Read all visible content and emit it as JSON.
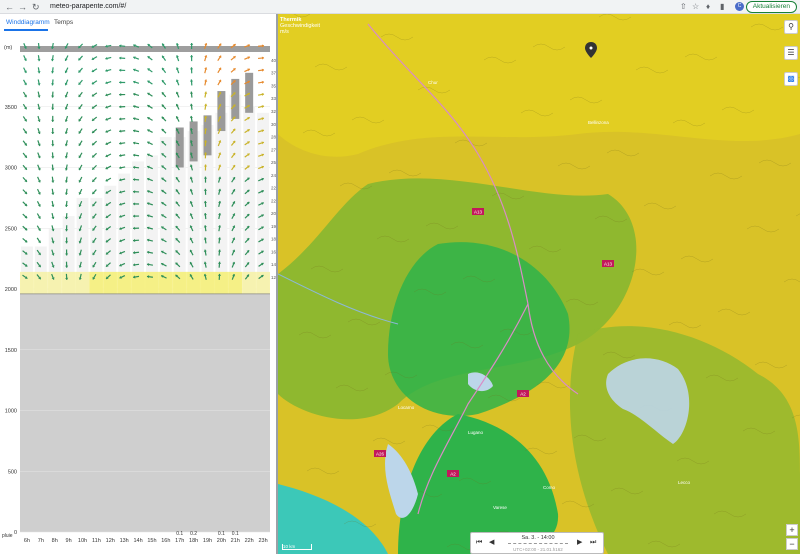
{
  "browser": {
    "url": "meteo-parapente.com/#/",
    "back_icon": "arrow-left-icon",
    "forward_icon": "arrow-right-icon",
    "reload_icon": "reload-icon",
    "update_label": "Aktualisieren",
    "avatar_letter": "C"
  },
  "tabs": [
    {
      "label": "Winddiagramm",
      "active": true
    },
    {
      "label": "Temps",
      "active": false
    }
  ],
  "chart_data": {
    "type": "wind-diagram",
    "ylabel": "(m)",
    "y_ticks": [
      0,
      500,
      1000,
      1500,
      2000,
      2500,
      3000,
      3500
    ],
    "y_range": [
      0,
      4000
    ],
    "x_labels": [
      "6h",
      "7h",
      "8h",
      "9h",
      "10h",
      "11h",
      "12h",
      "13h",
      "14h",
      "15h",
      "16h",
      "17h",
      "18h",
      "19h",
      "20h",
      "21h",
      "22h",
      "23h"
    ],
    "rain_labels": [
      "",
      "",
      "",
      "",
      "",
      "",
      "",
      "",
      "",
      "",
      "",
      "0.1",
      "0.2",
      "",
      "0.1",
      "0.1",
      "",
      ""
    ],
    "rain_unit": "pluie",
    "ground_level_m": 1960,
    "thermal_top_m": [
      2350,
      2350,
      2500,
      2600,
      2750,
      2750,
      2850,
      2950,
      3050,
      3100,
      3250,
      3250,
      3300,
      3350,
      3450,
      3600,
      3500,
      3450
    ],
    "cloud_base_m": [
      null,
      null,
      null,
      null,
      null,
      null,
      null,
      null,
      null,
      null,
      null,
      3000,
      3050,
      3100,
      3300,
      3400,
      3450,
      null
    ],
    "wind_speed_labels": [
      12,
      14,
      16,
      18,
      19,
      20,
      22,
      22,
      24,
      25,
      27,
      28,
      30,
      32,
      33,
      35,
      37,
      40
    ]
  },
  "map": {
    "legend_title": "Thermik",
    "legend_sub": "Geschwindigkeit",
    "legend_unit": "m/s",
    "player_time": "Sa. 3. - 14:00",
    "player_utc": "UTC+02:00 - 21.01.h162",
    "scale_label": "10 km",
    "road_labels": [
      "A13",
      "A13",
      "A2",
      "A2",
      "A26"
    ],
    "place_labels": [
      "Bellinzona",
      "Locarno",
      "Lugano",
      "Chur",
      "Varese",
      "Como",
      "Lecco"
    ],
    "colors": {
      "low": "#2fb34a",
      "mid": "#8fb82f",
      "high": "#d9c227",
      "vhigh": "#e8d520",
      "lake": "#bcd6ea"
    }
  },
  "map_tools": [
    "search-icon",
    "sliders-icon",
    "bar-chart-icon"
  ]
}
